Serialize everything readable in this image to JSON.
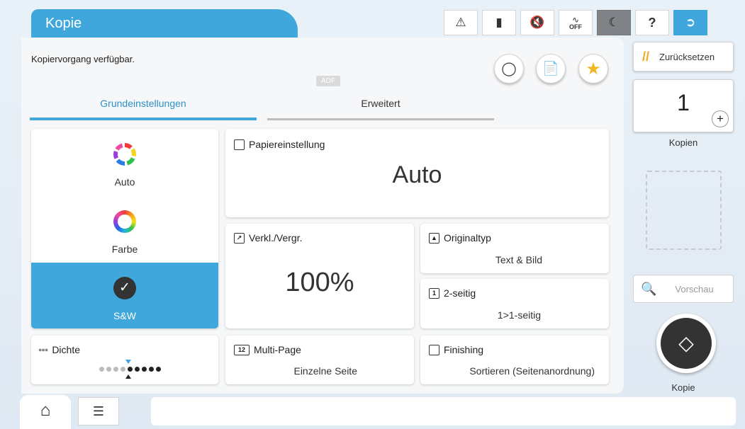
{
  "header": {
    "title": "Kopie",
    "icons": [
      "ink-warning-icon",
      "maintenance-box-icon",
      "sound-muted-icon",
      "power-off-schedule-icon",
      "sleep-moon-icon",
      "help-icon",
      "logout-icon"
    ],
    "off_label": "OFF",
    "help_glyph": "?"
  },
  "status": {
    "message": "Kopiervorgang verfügbar.",
    "adf_badge": "ADF"
  },
  "tabs": {
    "basic": "Grundeinstellungen",
    "advanced": "Erweitert"
  },
  "color_mode": {
    "options": [
      {
        "label": "Auto",
        "icon": "auto-color-ring-icon"
      },
      {
        "label": "Farbe",
        "icon": "color-ring-icon"
      },
      {
        "label": "S&W",
        "icon": "checkmark-icon",
        "selected": true
      }
    ]
  },
  "paper": {
    "label": "Papiereinstellung",
    "value": "Auto"
  },
  "scale": {
    "label": "Verkl./Vergr.",
    "value": "100%"
  },
  "original_type": {
    "label": "Originaltyp",
    "value": "Text & Bild"
  },
  "duplex": {
    "label": "2-seitig",
    "value": "1>1-seitig"
  },
  "density": {
    "label": "Dichte",
    "level": 5,
    "max": 9
  },
  "multipage": {
    "label": "Multi-Page",
    "value": "Einzelne Seite"
  },
  "finishing": {
    "label": "Finishing",
    "value": "Sortieren (Seitenanordnung)"
  },
  "right": {
    "reset_label": "Zurücksetzen",
    "copies_value": "1",
    "copies_label": "Kopien",
    "plus_glyph": "+",
    "preview_label": "Vorschau",
    "start_label": "Kopie"
  },
  "colors": {
    "accent": "#3fa7dc",
    "start_button": "#333333",
    "star": "#f2b824",
    "reset_icon": "#f2a91c"
  }
}
